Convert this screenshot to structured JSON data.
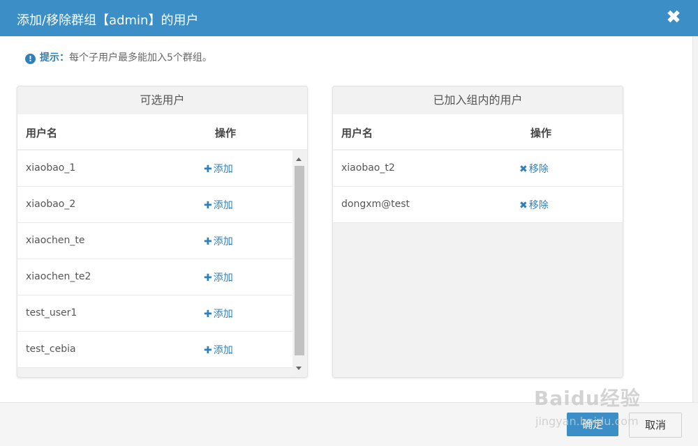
{
  "dialog": {
    "title": "添加/移除群组【admin】的用户",
    "close_symbol": "✖"
  },
  "hint": {
    "label": "提示：",
    "text": "每个子用户最多能加入5个群组。"
  },
  "available_panel": {
    "title": "可选用户",
    "col_name": "用户名",
    "col_action": "操作",
    "rows": [
      {
        "name": "xiaobao_1",
        "action": "添加"
      },
      {
        "name": "xiaobao_2",
        "action": "添加"
      },
      {
        "name": "xiaochen_te",
        "action": "添加"
      },
      {
        "name": "xiaochen_te2",
        "action": "添加"
      },
      {
        "name": "test_user1",
        "action": "添加"
      },
      {
        "name": "test_cebia",
        "action": "添加"
      }
    ]
  },
  "member_panel": {
    "title": "已加入组内的用户",
    "col_name": "用户名",
    "col_action": "操作",
    "rows": [
      {
        "name": "xiaobao_t2",
        "action": "移除"
      },
      {
        "name": "dongxm@test",
        "action": "移除"
      }
    ]
  },
  "footer": {
    "ok_label": "确定",
    "cancel_label": "取消"
  },
  "watermark": {
    "line1": "Baidu经验",
    "line2": "jingyan.baidu.com"
  },
  "icons": {
    "add": "plus-icon",
    "remove": "x-icon",
    "hint": "exclamation-circle-icon",
    "close": "close-icon"
  },
  "colors": {
    "accent": "#3b8fc6",
    "link": "#2f7fb8"
  }
}
